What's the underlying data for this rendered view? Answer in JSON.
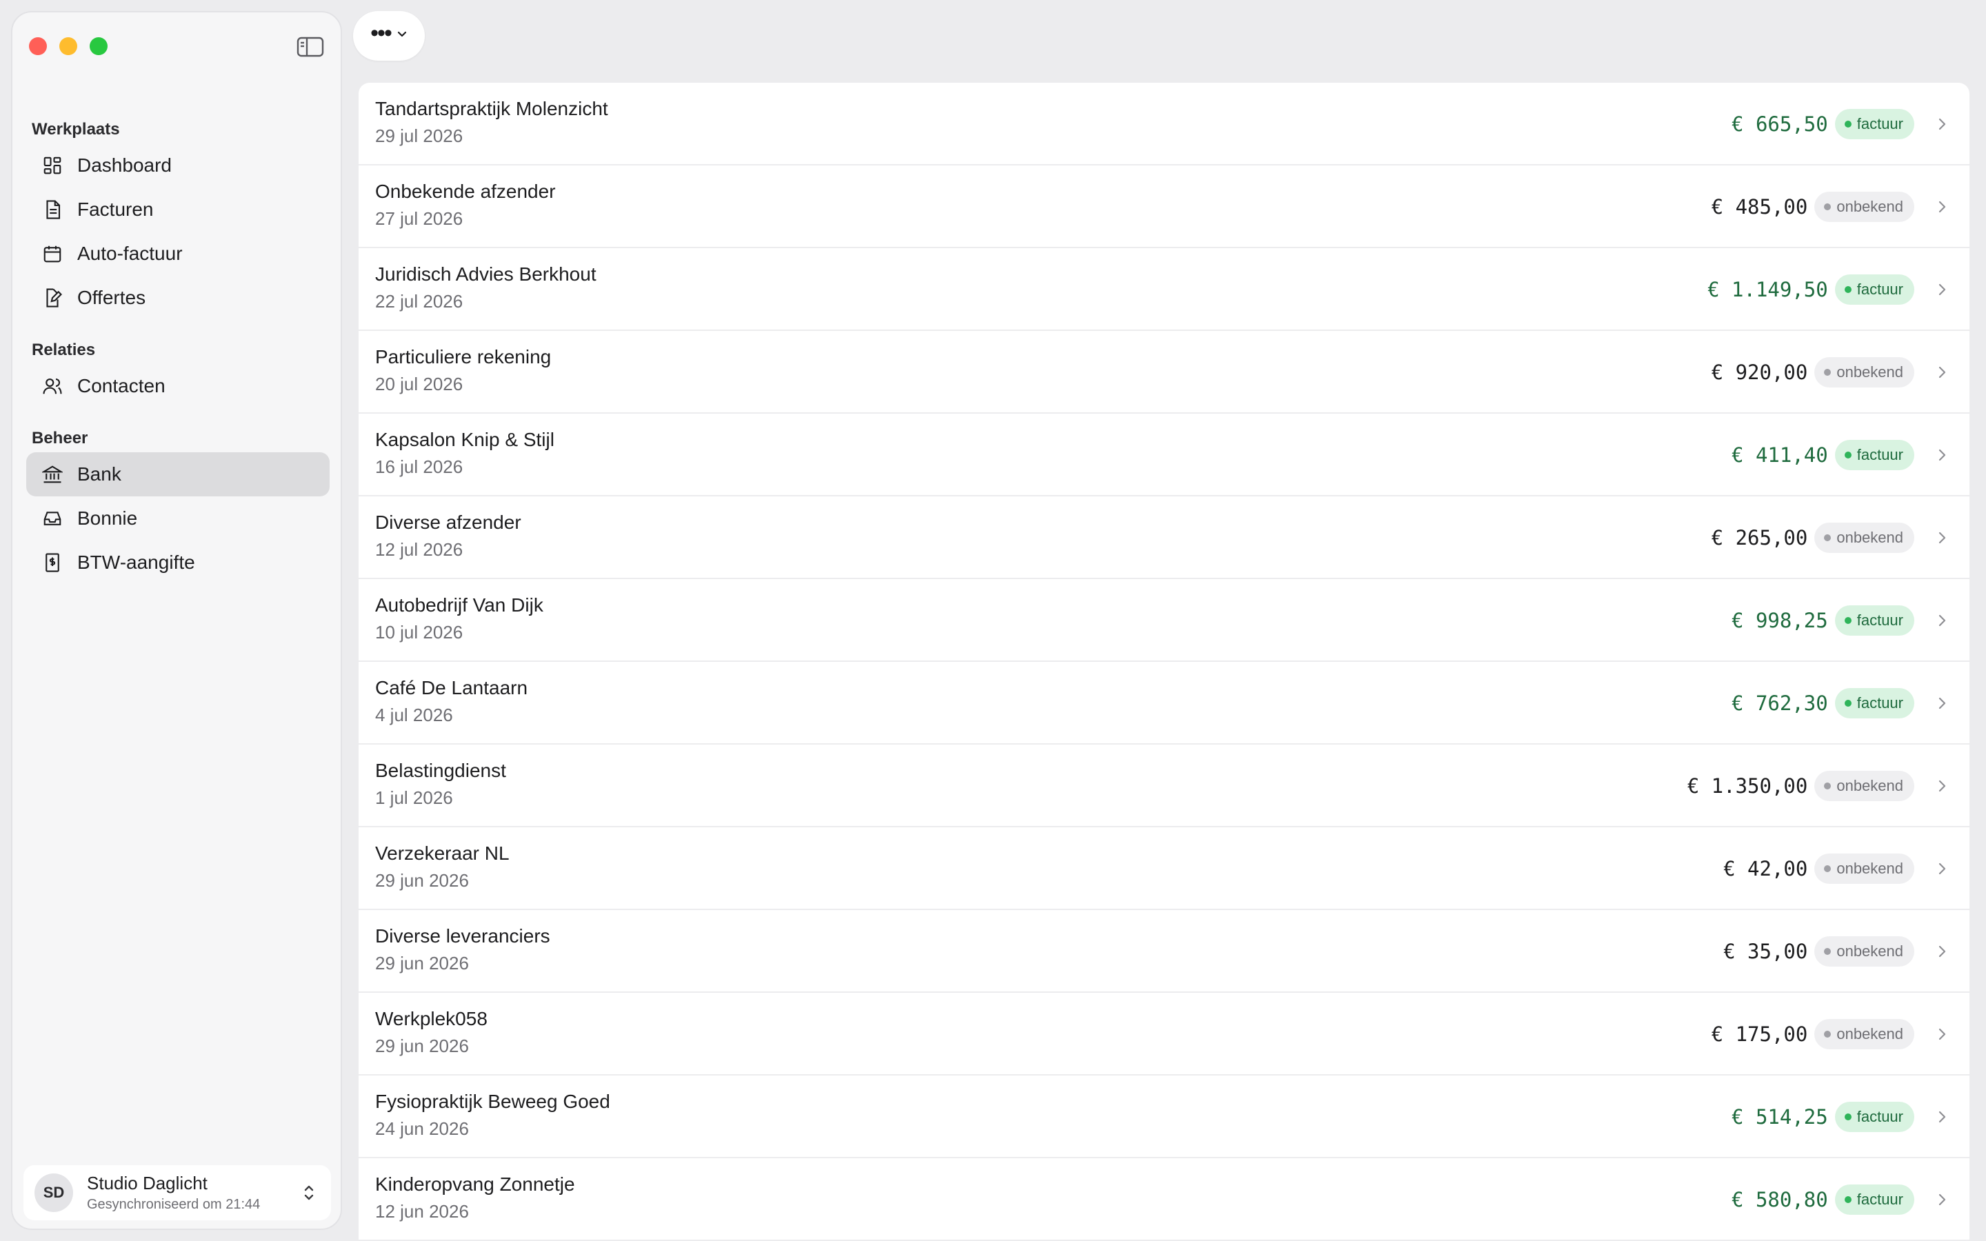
{
  "sidebar": {
    "sections": [
      {
        "label": "Werkplaats",
        "items": [
          {
            "label": "Dashboard",
            "icon": "dashboard-icon"
          },
          {
            "label": "Facturen",
            "icon": "document-icon"
          },
          {
            "label": "Auto-factuur",
            "icon": "calendar-icon"
          },
          {
            "label": "Offertes",
            "icon": "edit-document-icon"
          }
        ]
      },
      {
        "label": "Relaties",
        "items": [
          {
            "label": "Contacten",
            "icon": "people-icon"
          }
        ]
      },
      {
        "label": "Beheer",
        "items": [
          {
            "label": "Bank",
            "icon": "bank-icon",
            "active": true
          },
          {
            "label": "Bonnie",
            "icon": "inbox-icon"
          },
          {
            "label": "BTW-aangifte",
            "icon": "tax-document-icon"
          }
        ]
      }
    ],
    "account": {
      "initials": "SD",
      "name": "Studio Daglicht",
      "sync_status": "Gesynchroniseerd om 21:44"
    }
  },
  "colors": {
    "accent_green": "#2fb45a",
    "match_text": "#1f6b3e",
    "badge_match_bg": "#d9f3e1",
    "badge_unknown_bg": "#efeff1"
  },
  "transactions": [
    {
      "name": "Tandartspraktijk Molenzicht",
      "date": "29 jul 2026",
      "amount": "€ 665,50",
      "status": "factuur"
    },
    {
      "name": "Onbekende afzender",
      "date": "27 jul 2026",
      "amount": "€ 485,00",
      "status": "onbekend"
    },
    {
      "name": "Juridisch Advies Berkhout",
      "date": "22 jul 2026",
      "amount": "€ 1.149,50",
      "status": "factuur"
    },
    {
      "name": "Particuliere rekening",
      "date": "20 jul 2026",
      "amount": "€ 920,00",
      "status": "onbekend"
    },
    {
      "name": "Kapsalon Knip & Stijl",
      "date": "16 jul 2026",
      "amount": "€ 411,40",
      "status": "factuur"
    },
    {
      "name": "Diverse afzender",
      "date": "12 jul 2026",
      "amount": "€ 265,00",
      "status": "onbekend"
    },
    {
      "name": "Autobedrijf Van Dijk",
      "date": "10 jul 2026",
      "amount": "€ 998,25",
      "status": "factuur"
    },
    {
      "name": "Café De Lantaarn",
      "date": "4 jul 2026",
      "amount": "€ 762,30",
      "status": "factuur"
    },
    {
      "name": "Belastingdienst",
      "date": "1 jul 2026",
      "amount": "€ 1.350,00",
      "status": "onbekend"
    },
    {
      "name": "Verzekeraar NL",
      "date": "29 jun 2026",
      "amount": "€ 42,00",
      "status": "onbekend"
    },
    {
      "name": "Diverse leveranciers",
      "date": "29 jun 2026",
      "amount": "€ 35,00",
      "status": "onbekend"
    },
    {
      "name": "Werkplek058",
      "date": "29 jun 2026",
      "amount": "€ 175,00",
      "status": "onbekend"
    },
    {
      "name": "Fysiopraktijk Beweeg Goed",
      "date": "24 jun 2026",
      "amount": "€ 514,25",
      "status": "factuur"
    },
    {
      "name": "Kinderopvang Zonnetje",
      "date": "12 jun 2026",
      "amount": "€ 580,80",
      "status": "factuur"
    }
  ]
}
